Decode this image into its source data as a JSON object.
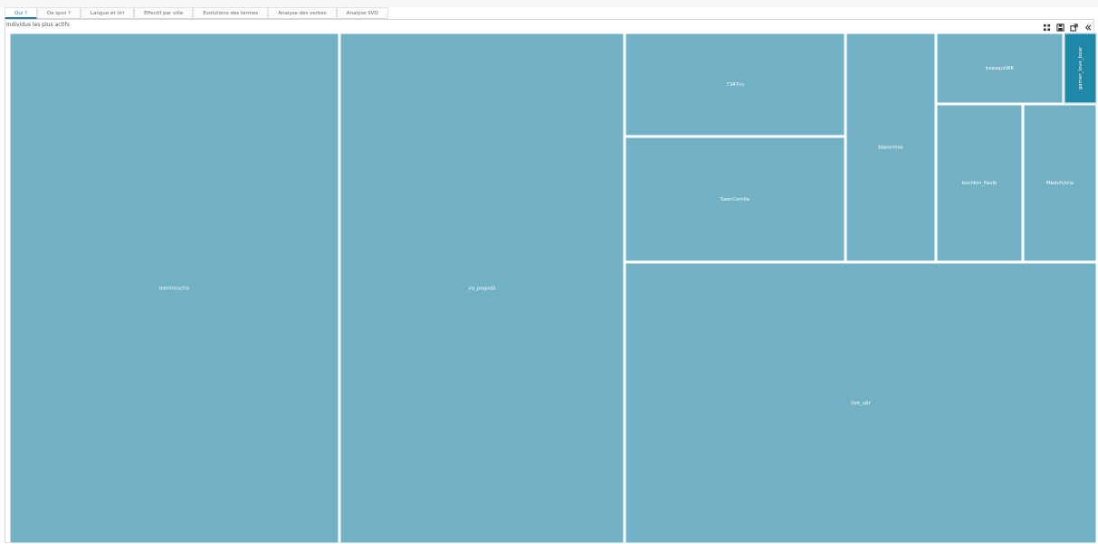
{
  "tabs": [
    {
      "label": "Qui ?",
      "active": true
    },
    {
      "label": "De quoi ?",
      "active": false
    },
    {
      "label": "Langue et Url",
      "active": false
    },
    {
      "label": "Effectif par ville",
      "active": false
    },
    {
      "label": "Evolutions des termes",
      "active": false
    },
    {
      "label": "Analyse des verbes",
      "active": false
    },
    {
      "label": "Analyse SVO",
      "active": false
    }
  ],
  "panel": {
    "title": "Individus les plus actifs"
  },
  "tools": [
    {
      "icon": "expand-grid-icon"
    },
    {
      "icon": "save-icon"
    },
    {
      "icon": "popout-icon"
    },
    {
      "icon": "collapse-icon"
    }
  ],
  "chart_data": {
    "type": "treemap",
    "colors": {
      "tile": "#72b1c4",
      "tile_highlight": "#1e88a8",
      "border": "#ffffff",
      "label": "#ffffff"
    },
    "tiles": [
      {
        "label": "lemininscha",
        "highlight": false
      },
      {
        "label": "va_pogoda",
        "highlight": false
      },
      {
        "label": "7347ru",
        "highlight": false
      },
      {
        "label": "SaecComila",
        "highlight": false
      },
      {
        "label": "live_ubr",
        "highlight": false
      },
      {
        "label": "bbpormos",
        "highlight": false
      },
      {
        "label": "beesquitRK",
        "highlight": false
      },
      {
        "label": "gamer_love_bear",
        "highlight": true
      },
      {
        "label": "bochkin_Pavlk",
        "highlight": false
      },
      {
        "label": "Medvfshria",
        "highlight": false
      }
    ]
  }
}
